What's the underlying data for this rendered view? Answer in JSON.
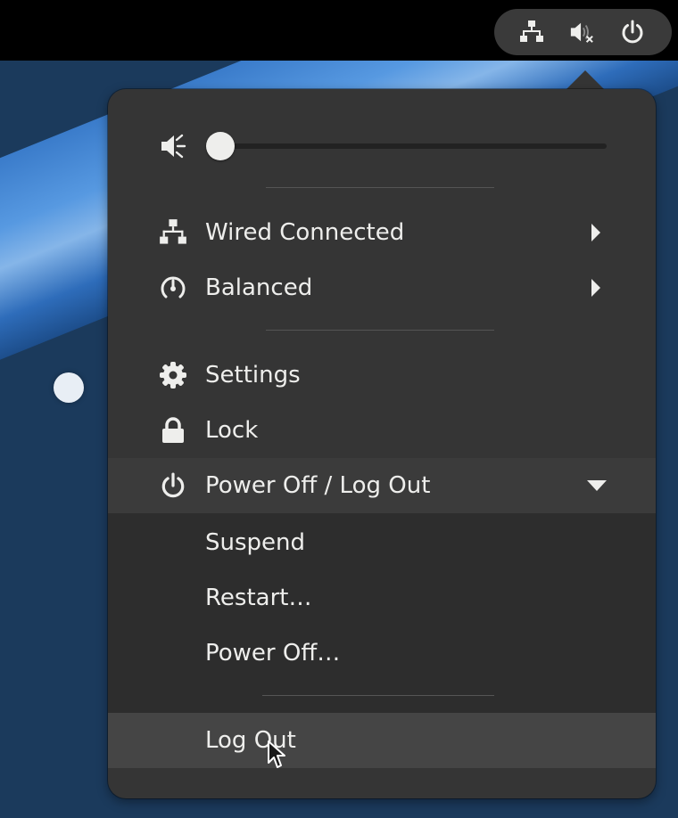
{
  "colors": {
    "accent_text": "#eeeeec",
    "menu_bg": "#353535",
    "submenu_bg": "#2d2d2d",
    "topbar_bg": "#000000",
    "desktop_bg": "#1b3a5c"
  },
  "topbar": {
    "status_icons": [
      "network-wired-icon",
      "audio-volume-muted-icon",
      "system-shutdown-icon"
    ]
  },
  "menu": {
    "volume": {
      "icon": "audio-volume-muted-icon",
      "level": 0
    },
    "network": {
      "label": "Wired Connected",
      "icon": "network-wired-icon"
    },
    "power_mode": {
      "label": "Balanced",
      "icon": "power-profile-balanced-icon"
    },
    "settings": {
      "label": "Settings",
      "icon": "gear-icon"
    },
    "lock": {
      "label": "Lock",
      "icon": "lock-icon"
    },
    "power": {
      "label": "Power Off / Log Out",
      "icon": "power-icon",
      "expanded": true,
      "items": [
        {
          "label": "Suspend"
        },
        {
          "label": "Restart…"
        },
        {
          "label": "Power Off…"
        }
      ],
      "logout_label": "Log Out"
    }
  }
}
